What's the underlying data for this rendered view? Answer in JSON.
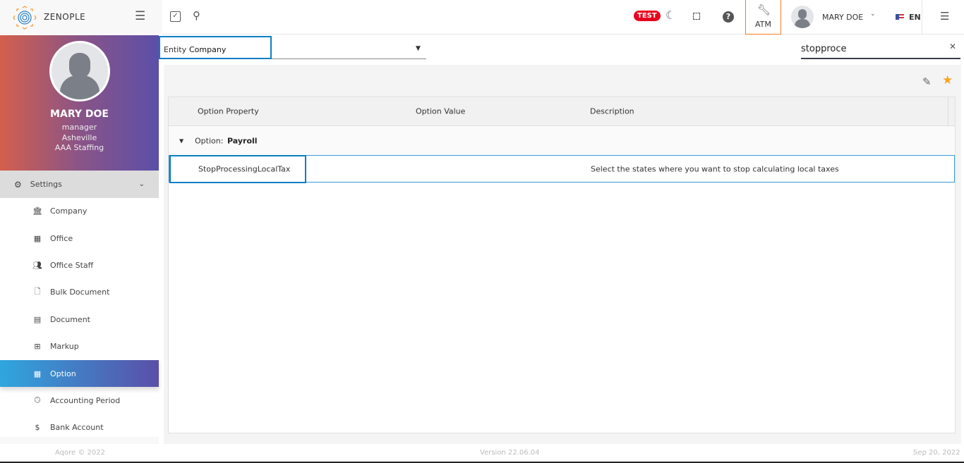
{
  "app": {
    "name": "ZENOPLE"
  },
  "topbar": {
    "test_badge": "TEST",
    "atm_label": "ATM",
    "user_name": "MARY DOE",
    "language": "EN"
  },
  "profile": {
    "name": "MARY DOE",
    "role": "manager",
    "office": "Asheville",
    "company": "AAA Staffing"
  },
  "sidebar": {
    "section": "Settings",
    "items": [
      {
        "label": "Company",
        "icon": "bank-icon"
      },
      {
        "label": "Office",
        "icon": "building-icon"
      },
      {
        "label": "Office Staff",
        "icon": "people-icon"
      },
      {
        "label": "Bulk Document",
        "icon": "file-icon"
      },
      {
        "label": "Document",
        "icon": "documents-icon"
      },
      {
        "label": "Markup",
        "icon": "grid-icon"
      },
      {
        "label": "Option",
        "icon": "apps-icon",
        "active": true
      },
      {
        "label": "Accounting Period",
        "icon": "clock-icon"
      },
      {
        "label": "Bank Account",
        "icon": "dollar-icon"
      }
    ]
  },
  "filter": {
    "entity_label": "Entity",
    "entity_value": "Company",
    "search_value": "stopproce"
  },
  "table": {
    "columns": [
      "Option Property",
      "Option Value",
      "Description"
    ],
    "group": {
      "label": "Option:",
      "value": "Payroll"
    },
    "rows": [
      {
        "property": "StopProcessingLocalTax",
        "value": "",
        "description": "Select the states where you want to stop calculating local taxes"
      }
    ]
  },
  "footer": {
    "copyright": "Aqore © 2022",
    "version": "Version 22.06.04",
    "date": "Sep 20, 2022"
  },
  "colors": {
    "accent": "#0a7fc2",
    "highlight": "#f47c20",
    "test": "#e8001c",
    "star": "#f5a623"
  }
}
